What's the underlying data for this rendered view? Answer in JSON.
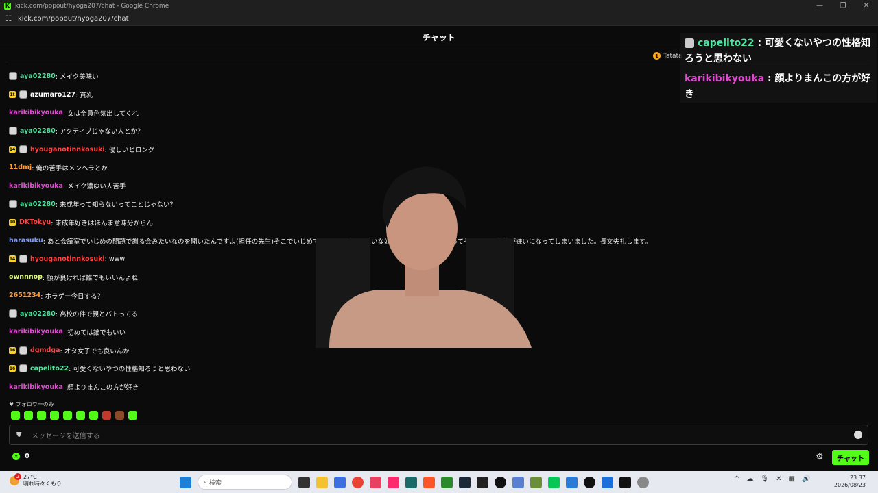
{
  "window": {
    "title": "kick.com/popout/hyoga207/chat - Google Chrome",
    "url": "kick.com/popout/hyoga207/chat",
    "buttons": [
      "—",
      "❐",
      "✕"
    ]
  },
  "chat": {
    "header": "チャット",
    "pinned_user": "Tatata",
    "messages": [
      {
        "user": "aya02280",
        "color": "#4ee6a0",
        "badge": "",
        "avatar": true,
        "text": ": メイク美味い"
      },
      {
        "user": "azumaro127",
        "color": "#ffffff",
        "badge": "1t",
        "avatar": true,
        "text": ": 貧乳"
      },
      {
        "user": "karikibikyouka",
        "color": "#e04ad0",
        "badge": "",
        "avatar": false,
        "text": ": 女は全員色気出してくれ"
      },
      {
        "user": "aya02280",
        "color": "#4ee6a0",
        "badge": "",
        "avatar": true,
        "text": ": アクティブじゃない人とか？"
      },
      {
        "user": "hyouganotinnkosuki",
        "color": "#ff4545",
        "badge": "14",
        "avatar": true,
        "text": ": 優しいとロング"
      },
      {
        "user": "11dmj",
        "color": "#ff9d3a",
        "badge": "",
        "avatar": false,
        "text": ": 俺の苦手はメンヘラとか"
      },
      {
        "user": "karikibikyouka",
        "color": "#e04ad0",
        "badge": "",
        "avatar": false,
        "text": ": メイク濃ゆい人苦手"
      },
      {
        "user": "aya02280",
        "color": "#4ee6a0",
        "badge": "",
        "avatar": true,
        "text": ": 未成年って知らないってことじゃない？"
      },
      {
        "user": "DKTokyu",
        "color": "#ff4545",
        "badge": "10",
        "avatar": false,
        "text": ": 未成年好きはほんま意味分からん"
      },
      {
        "user": "harasuku",
        "color": "#7d9bff",
        "badge": "",
        "avatar": false,
        "text": ": あと会議室でいじめの問題で謝る会みたいなのを開いたんですよ(担任の先生)そこでいじめてくるリーダーみたいな奴が「                ブチギレてしまってそこから、学校が嫌いになってしまいました。長文失礼します。"
      },
      {
        "user": "hyouganotinnkosuki",
        "color": "#ff4545",
        "badge": "14",
        "avatar": true,
        "text": ": www"
      },
      {
        "user": "ownnnop",
        "color": "#d9f57a",
        "badge": "",
        "avatar": false,
        "text": ": 顔が良ければ誰でもいいんよね"
      },
      {
        "user": "2651234",
        "color": "#ff9d3a",
        "badge": "",
        "avatar": false,
        "text": ": ホラゲー今日する？"
      },
      {
        "user": "aya02280",
        "color": "#4ee6a0",
        "badge": "",
        "avatar": true,
        "text": ": 高校の件で親とバトってる"
      },
      {
        "user": "karikibikyouka",
        "color": "#e04ad0",
        "badge": "",
        "avatar": false,
        "text": ": 初めては誰でもいい"
      },
      {
        "user": "dgmdga",
        "color": "#ff4545",
        "badge": "16",
        "avatar": true,
        "text": ": オタ女子でも良いんか"
      },
      {
        "user": "capelito22",
        "color": "#4ee6a0",
        "badge": "16",
        "avatar": true,
        "text": ": 可愛くないやつの性格知ろうと思わない"
      },
      {
        "user": "karikibikyouka",
        "color": "#e04ad0",
        "badge": "",
        "avatar": false,
        "text": ": 顔よりまんこの方が好き"
      }
    ],
    "followers_only": "フォロワーのみ",
    "input_placeholder": "メッセージを送信する",
    "points": "0",
    "send_label": "チャット"
  },
  "overlay": {
    "line1_user": "capelito22",
    "line1_text": " : 可愛くないやつの性格知ろうと思わない",
    "line2_user": "karikibikyouka",
    "line2_text": " : 顔よりまんこの方が好き"
  },
  "taskbar": {
    "temperature": "27°C",
    "weather": "晴れ時々くもり",
    "notification_count": "2",
    "search_placeholder": "検索",
    "time": "23:37",
    "date": "2026/08/23"
  },
  "colors": {
    "accent": "#53fc18",
    "bg": "#0b0b0c"
  }
}
